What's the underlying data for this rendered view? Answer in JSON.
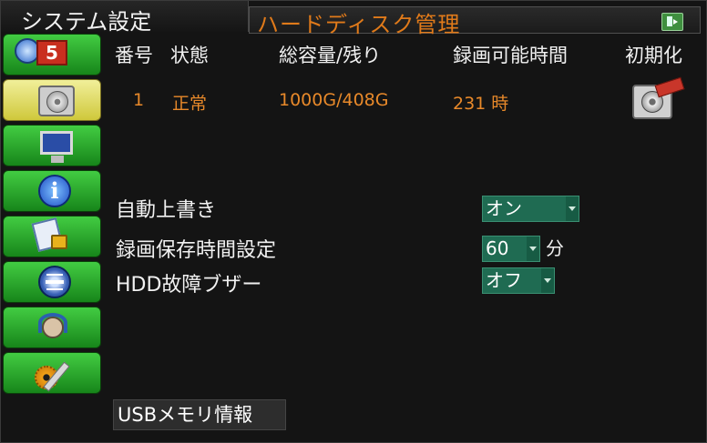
{
  "top_tab": {
    "label": "システム設定"
  },
  "header": {
    "title": "ハードディスク管理",
    "exit_icon": "exit-door-icon"
  },
  "sidebar": {
    "items": [
      {
        "icon": "clock-calendar-icon",
        "badge": "5"
      },
      {
        "icon": "hard-disk-icon",
        "active": true
      },
      {
        "icon": "monitor-icon"
      },
      {
        "icon": "info-icon",
        "glyph": "i"
      },
      {
        "icon": "document-lock-icon"
      },
      {
        "icon": "network-globe-icon"
      },
      {
        "icon": "headset-support-icon"
      },
      {
        "icon": "gear-tools-icon"
      }
    ]
  },
  "hdd_table": {
    "headers": [
      "番号",
      "状態",
      "総容量/残り",
      "録画可能時間",
      "初期化"
    ],
    "rows": [
      {
        "number": "1",
        "status": "正常",
        "capacity": "1000G/408G",
        "rec_time": "231 時",
        "format_icon": "format-disk-icon"
      }
    ]
  },
  "settings": {
    "auto_overwrite": {
      "label": "自動上書き",
      "value": "オン"
    },
    "retention": {
      "label": "録画保存時間設定",
      "value": "60",
      "unit": "分"
    },
    "hdd_buzzer": {
      "label": "HDD故障ブザー",
      "value": "オフ"
    }
  },
  "usb_button": {
    "label": "USBメモリ情報"
  },
  "colors": {
    "accent_orange": "#e07a1a",
    "nav_green": "#2aa62a",
    "nav_active": "#e3dd62",
    "select_green": "#1f6b52"
  }
}
